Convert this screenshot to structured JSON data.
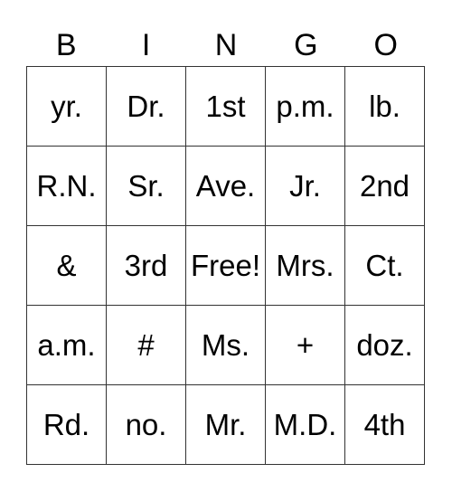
{
  "header": [
    "B",
    "I",
    "N",
    "G",
    "O"
  ],
  "rows": [
    [
      "yr.",
      "Dr.",
      "1st",
      "p.m.",
      "lb."
    ],
    [
      "R.N.",
      "Sr.",
      "Ave.",
      "Jr.",
      "2nd"
    ],
    [
      "&",
      "3rd",
      "Free!",
      "Mrs.",
      "Ct."
    ],
    [
      "a.m.",
      "#",
      "Ms.",
      "+",
      "doz."
    ],
    [
      "Rd.",
      "no.",
      "Mr.",
      "M.D.",
      "4th"
    ]
  ]
}
